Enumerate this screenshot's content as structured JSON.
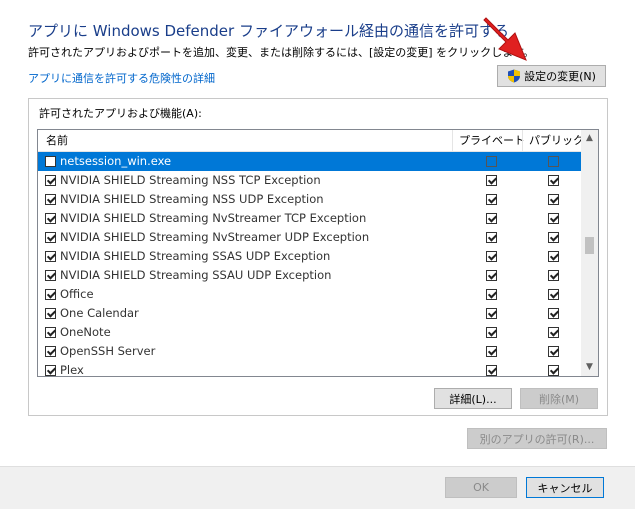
{
  "header": {
    "title": "アプリに Windows Defender ファイアウォール経由の通信を許可する",
    "description": "許可されたアプリおよびポートを追加、変更、または削除するには、[設定の変更] をクリックします。",
    "risk_link": "アプリに通信を許可する危険性の詳細",
    "change_settings_label": "設定の変更(N)"
  },
  "group": {
    "label": "許可されたアプリおよび機能(A):",
    "columns": {
      "name": "名前",
      "private": "プライベート",
      "public": "パブリック"
    },
    "rows": [
      {
        "name": "netsession_win.exe",
        "enabled": false,
        "private": false,
        "public": false,
        "selected": true
      },
      {
        "name": "NVIDIA SHIELD Streaming NSS TCP Exception",
        "enabled": true,
        "private": true,
        "public": true
      },
      {
        "name": "NVIDIA SHIELD Streaming NSS UDP Exception",
        "enabled": true,
        "private": true,
        "public": true
      },
      {
        "name": "NVIDIA SHIELD Streaming NvStreamer TCP Exception",
        "enabled": true,
        "private": true,
        "public": true
      },
      {
        "name": "NVIDIA SHIELD Streaming NvStreamer UDP Exception",
        "enabled": true,
        "private": true,
        "public": true
      },
      {
        "name": "NVIDIA SHIELD Streaming SSAS UDP Exception",
        "enabled": true,
        "private": true,
        "public": true
      },
      {
        "name": "NVIDIA SHIELD Streaming SSAU UDP Exception",
        "enabled": true,
        "private": true,
        "public": true
      },
      {
        "name": "Office",
        "enabled": true,
        "private": true,
        "public": true
      },
      {
        "name": "One Calendar",
        "enabled": true,
        "private": true,
        "public": true
      },
      {
        "name": "OneNote",
        "enabled": true,
        "private": true,
        "public": true
      },
      {
        "name": "OpenSSH Server",
        "enabled": true,
        "private": true,
        "public": true
      },
      {
        "name": "Plex",
        "enabled": true,
        "private": true,
        "public": true
      }
    ],
    "details_label": "詳細(L)...",
    "remove_label": "削除(M)"
  },
  "other_app_label": "別のアプリの許可(R)...",
  "footer": {
    "ok_label": "OK",
    "cancel_label": "キャンセル"
  },
  "colors": {
    "title": "#1a3e8a",
    "link": "#0066cc",
    "selection": "#0078d7",
    "arrow": "#e02020"
  }
}
